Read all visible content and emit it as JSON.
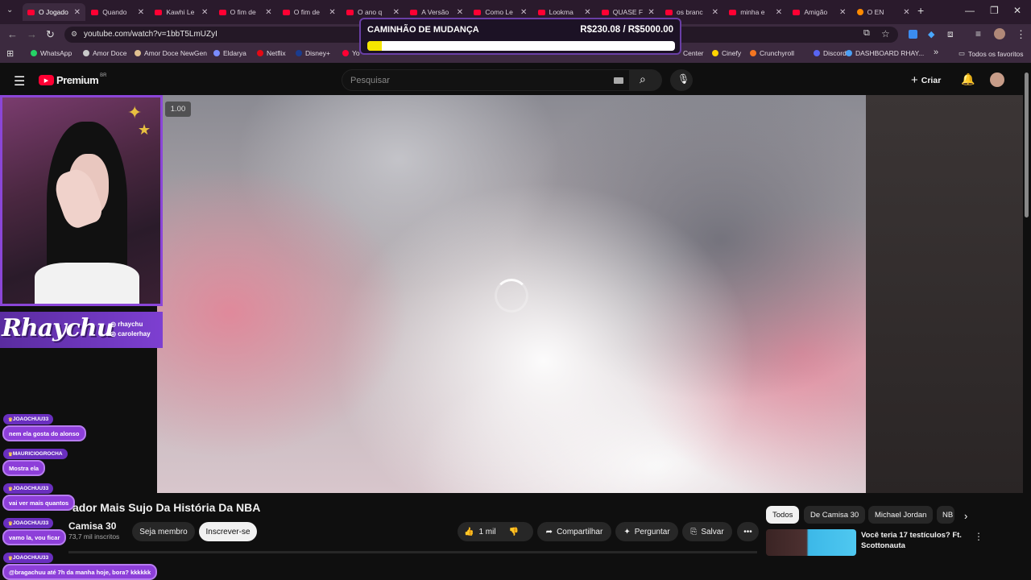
{
  "browser": {
    "tabs": [
      {
        "title": "O Jogado",
        "active": true
      },
      {
        "title": "Quando"
      },
      {
        "title": "Kawhi Le"
      },
      {
        "title": "O fim de"
      },
      {
        "title": "O fim de"
      },
      {
        "title": "O ano q"
      },
      {
        "title": "A Versão"
      },
      {
        "title": "Como Le"
      },
      {
        "title": "Lookma"
      },
      {
        "title": "QUASE F"
      },
      {
        "title": "os branc"
      },
      {
        "title": "minha e"
      },
      {
        "title": "Amigão"
      },
      {
        "title": "O EN"
      }
    ],
    "new_tab": "+",
    "url": "youtube.com/watch?v=1bbT5LmUZyI",
    "bookmarks": [
      {
        "label": "WhatsApp",
        "color": "#25d366"
      },
      {
        "label": "Amor Doce",
        "color": "#c9c9c9"
      },
      {
        "label": "Amor Doce NewGen",
        "color": "#e0c090"
      },
      {
        "label": "Eldarya",
        "color": "#7a8cff"
      },
      {
        "label": "Netflix",
        "color": "#e50914"
      },
      {
        "label": "Disney+",
        "color": "#1a3c8f"
      },
      {
        "label": "Yo",
        "color": "#ff0033"
      },
      {
        "label": "Center",
        "color": ""
      },
      {
        "label": "Cinefy",
        "color": "#ffd400"
      },
      {
        "label": "Crunchyroll",
        "color": "#f47521"
      },
      {
        "label": "Discord",
        "color": "#5865f2"
      },
      {
        "label": "DASHBOARD RHAY...",
        "color": "#4a9ff5"
      }
    ],
    "more_bookmarks": "»",
    "all_favorites": "Todos os favoritos"
  },
  "goal": {
    "title": "CAMINHÃO DE MUDANÇA",
    "amount": "R$230.08 / R$5000.00",
    "progress": 0.046,
    "bar_color": "#f5e600"
  },
  "youtube": {
    "logo": "Premium",
    "region": "BR",
    "search_placeholder": "Pesquisar",
    "create_label": "Criar",
    "speed": "1.00",
    "video_title": "ador Mais Sujo Da História Da NBA",
    "channel": "Camisa 30",
    "subscribers": "73,7 mil inscritos",
    "join_label": "Seja membro",
    "subscribe_label": "Inscrever-se",
    "likes": "1 mil",
    "share_label": "Compartilhar",
    "ask_label": "Perguntar",
    "save_label": "Salvar",
    "chips": [
      "Todos",
      "De Camisa 30",
      "Michael Jordan",
      "NB"
    ],
    "rec_title": "Você teria 17 testículos? Ft. Scottonauta"
  },
  "stream": {
    "name": "Rhaychu",
    "handles": [
      "rhaychu",
      "carolerhay"
    ],
    "chat": [
      {
        "user": "JOAOCHUU33",
        "msg": "nem ela gosta do alonso"
      },
      {
        "user": "MAURICIOGROCHA",
        "msg": "Mostra ela"
      },
      {
        "user": "JOAOCHUU33",
        "msg": "vai ver mais quantos"
      },
      {
        "user": "JOAOCHUU33",
        "msg": "vamo la, vou ficar"
      },
      {
        "user": "JOAOCHUU33",
        "msg": "@bragachuu até 7h da manha hoje, bora? kkkkkk"
      }
    ]
  }
}
